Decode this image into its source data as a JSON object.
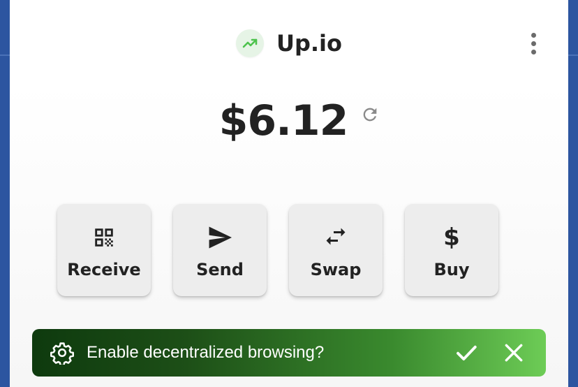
{
  "header": {
    "title": "Up.io",
    "logo_icon": "trending-up-icon",
    "menu_icon": "more-vertical-icon"
  },
  "balance": {
    "amount": "$6.12",
    "refresh_icon": "refresh-icon"
  },
  "actions": [
    {
      "label": "Receive",
      "icon": "qr-code-icon"
    },
    {
      "label": "Send",
      "icon": "send-icon"
    },
    {
      "label": "Swap",
      "icon": "swap-icon"
    },
    {
      "label": "Buy",
      "icon": "dollar-icon",
      "glyph": "$"
    }
  ],
  "banner": {
    "text": "Enable decentralized browsing?",
    "icon": "gear-icon",
    "confirm_icon": "check-icon",
    "dismiss_icon": "close-icon"
  },
  "colors": {
    "background": "#2c55a0",
    "accent_green": "#4cc24c",
    "banner_start": "#0e3a0e",
    "banner_end": "#6dcc56",
    "text_dark": "#222222"
  }
}
